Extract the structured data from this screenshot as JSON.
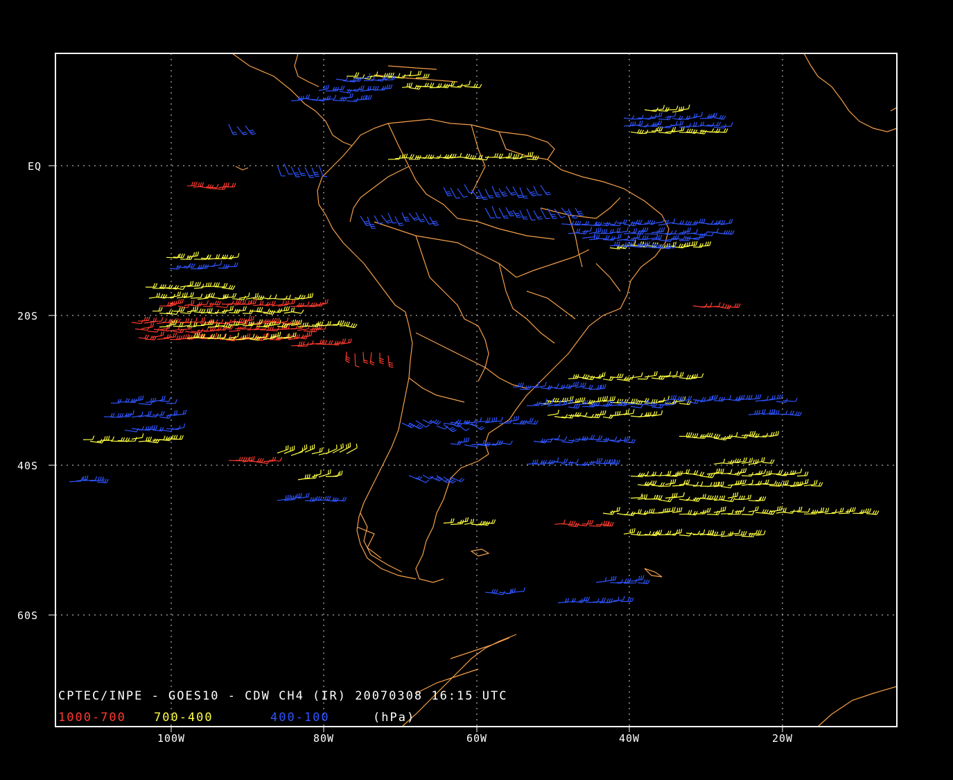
{
  "map": {
    "caption": "CPTEC/INPE - GOES10 - CDW CH4 (IR) 20070308 16:15 UTC",
    "legend": [
      {
        "label": "1000-700",
        "color": "#ff3b2f"
      },
      {
        "label": "700-400",
        "color": "#ffff44"
      },
      {
        "label": "400-100",
        "color": "#2f55ff"
      }
    ],
    "legend_units": "(hPa)",
    "lat_labels": [
      "EQ",
      "20S",
      "40S",
      "60S"
    ],
    "lon_labels": [
      "100W",
      "80W",
      "60W",
      "40W",
      "20W"
    ],
    "colors": {
      "background": "#000000",
      "frame": "#ffffff",
      "coastline": "#f5a04a",
      "grid": "#ffffff"
    }
  }
}
